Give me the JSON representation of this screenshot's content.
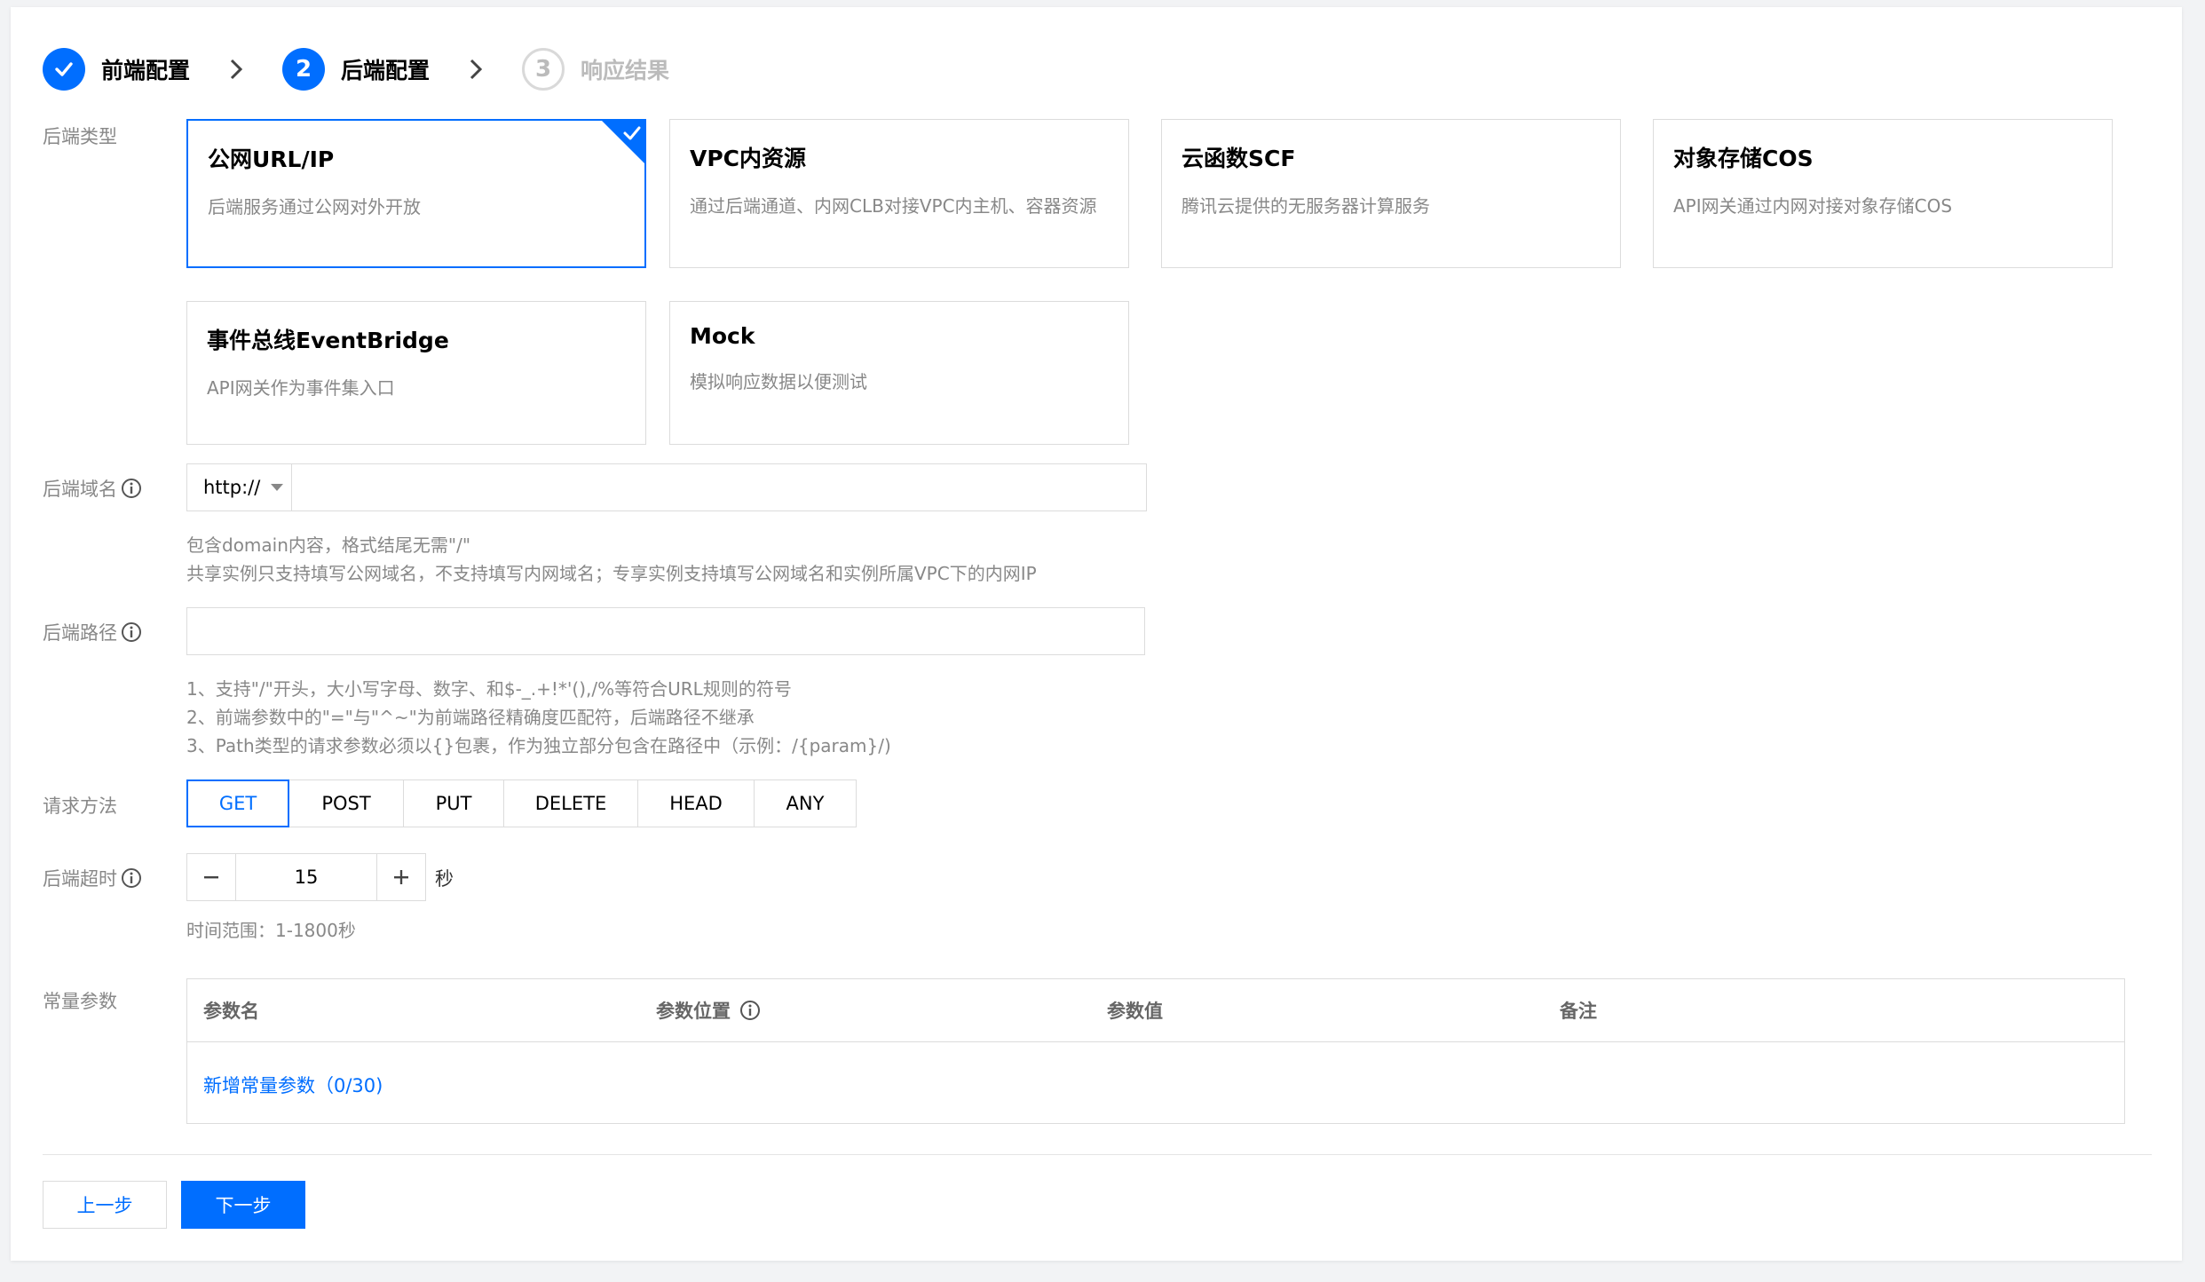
{
  "steps": [
    {
      "label": "前端配置",
      "state": "done"
    },
    {
      "label": "后端配置",
      "state": "active",
      "number": "2"
    },
    {
      "label": "响应结果",
      "state": "todo",
      "number": "3"
    }
  ],
  "backend_type": {
    "label": "后端类型",
    "cards": [
      {
        "title": "公网URL/IP",
        "desc": "后端服务通过公网对外开放",
        "selected": true
      },
      {
        "title": "VPC内资源",
        "desc": "通过后端通道、内网CLB对接VPC内主机、容器资源",
        "selected": false
      },
      {
        "title": "云函数SCF",
        "desc": "腾讯云提供的无服务器计算服务",
        "selected": false
      },
      {
        "title": "对象存储COS",
        "desc": "API网关通过内网对接对象存储COS",
        "selected": false
      },
      {
        "title": "事件总线EventBridge",
        "desc": "API网关作为事件集入口",
        "selected": false
      },
      {
        "title": "Mock",
        "desc": "模拟响应数据以便测试",
        "selected": false
      }
    ]
  },
  "backend_domain": {
    "label": "后端域名",
    "protocol": "http://",
    "value": "",
    "help1": "包含domain内容，格式结尾无需\"/\"",
    "help2": "共享实例只支持填写公网域名，不支持填写内网域名；专享实例支持填写公网域名和实例所属VPC下的内网IP"
  },
  "backend_path": {
    "label": "后端路径",
    "value": "",
    "help1": "1、支持\"/\"开头，大小写字母、数字、和$-_.+!*'(),/%等符合URL规则的符号",
    "help2": "2、前端参数中的\"=\"与\"^~\"为前端路径精确度匹配符，后端路径不继承",
    "help3": "3、Path类型的请求参数必须以{}包裹，作为独立部分包含在路径中（示例：/{param}/)"
  },
  "request_method": {
    "label": "请求方法",
    "options": [
      "GET",
      "POST",
      "PUT",
      "DELETE",
      "HEAD",
      "ANY"
    ],
    "selected": "GET"
  },
  "backend_timeout": {
    "label": "后端超时",
    "value": "15",
    "unit": "秒",
    "help": "时间范围：1-1800秒"
  },
  "constant_params": {
    "label": "常量参数",
    "columns": [
      "参数名",
      "参数位置",
      "参数值",
      "备注"
    ],
    "add_link": "新增常量参数（0/30)"
  },
  "footer": {
    "prev": "上一步",
    "next": "下一步"
  },
  "colors": {
    "accent": "#006eff",
    "muted": "#888888",
    "border": "#dcdcdc"
  }
}
